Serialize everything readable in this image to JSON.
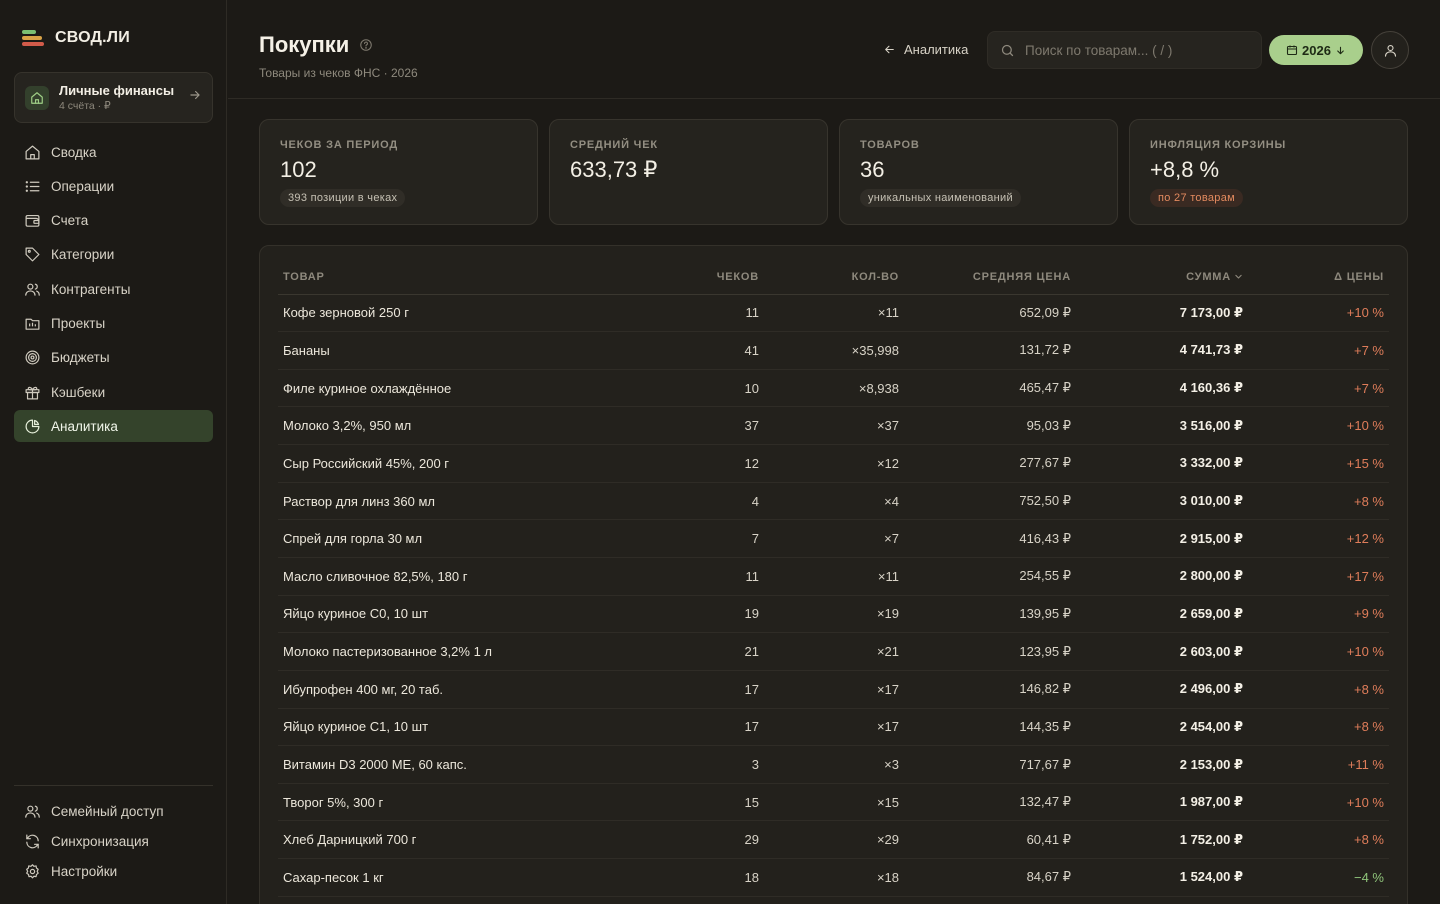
{
  "app": {
    "logo": "СВОД.ЛИ"
  },
  "account": {
    "name": "Личные финансы",
    "sub": "4 счёта · ₽"
  },
  "nav": [
    {
      "label": "Сводка",
      "icon": "home-icon"
    },
    {
      "label": "Операции",
      "icon": "list-icon"
    },
    {
      "label": "Счета",
      "icon": "wallet-icon"
    },
    {
      "label": "Категории",
      "icon": "tag-icon"
    },
    {
      "label": "Контрагенты",
      "icon": "users-icon"
    },
    {
      "label": "Проекты",
      "icon": "folder-icon"
    },
    {
      "label": "Бюджеты",
      "icon": "target-icon"
    },
    {
      "label": "Кэшбеки",
      "icon": "gift-icon"
    },
    {
      "label": "Аналитика",
      "icon": "pie-chart-icon",
      "active": true
    }
  ],
  "nav_bottom": [
    {
      "label": "Семейный доступ",
      "icon": "family-icon"
    },
    {
      "label": "Синхронизация",
      "icon": "sync-icon"
    },
    {
      "label": "Настройки",
      "icon": "gear-icon"
    }
  ],
  "header": {
    "title": "Покупки",
    "subtitle": "Товары из чеков ФНС · 2026",
    "back_label": "Аналитика",
    "search_placeholder": "Поиск по товарам... ( / )",
    "year": "2026"
  },
  "stats": [
    {
      "label": "ЧЕКОВ ЗА ПЕРИОД",
      "value": "102",
      "badge": "393 позиции в чеках",
      "badge_style": "neutral"
    },
    {
      "label": "СРЕДНИЙ ЧЕК",
      "value": "633,73 ₽",
      "badge": "",
      "badge_style": "none"
    },
    {
      "label": "ТОВАРОВ",
      "value": "36",
      "badge": "уникальных наименований",
      "badge_style": "neutral"
    },
    {
      "label": "ИНФЛЯЦИЯ КОРЗИНЫ",
      "value": "+8,8 %",
      "badge": "по 27 товарам",
      "badge_style": "warn"
    }
  ],
  "table": {
    "columns": [
      "ТОВАР",
      "ЧЕКОВ",
      "КОЛ-ВО",
      "СРЕДНЯЯ ЦЕНА",
      "СУММА",
      "Δ ЦЕНЫ"
    ],
    "rows": [
      {
        "name": "Кофе зерновой 250 г",
        "checks": "11",
        "qty": "×11",
        "avg": "652,09 ₽",
        "sum": "7 173,00 ₽",
        "delta": "+10 %",
        "trend": "up"
      },
      {
        "name": "Бананы",
        "checks": "41",
        "qty": "×35,998",
        "avg": "131,72 ₽",
        "sum": "4 741,73 ₽",
        "delta": "+7 %",
        "trend": "up"
      },
      {
        "name": "Филе куриное охлаждённое",
        "checks": "10",
        "qty": "×8,938",
        "avg": "465,47 ₽",
        "sum": "4 160,36 ₽",
        "delta": "+7 %",
        "trend": "up"
      },
      {
        "name": "Молоко 3,2%, 950 мл",
        "checks": "37",
        "qty": "×37",
        "avg": "95,03 ₽",
        "sum": "3 516,00 ₽",
        "delta": "+10 %",
        "trend": "up"
      },
      {
        "name": "Сыр Российский 45%, 200 г",
        "checks": "12",
        "qty": "×12",
        "avg": "277,67 ₽",
        "sum": "3 332,00 ₽",
        "delta": "+15 %",
        "trend": "up"
      },
      {
        "name": "Раствор для линз 360 мл",
        "checks": "4",
        "qty": "×4",
        "avg": "752,50 ₽",
        "sum": "3 010,00 ₽",
        "delta": "+8 %",
        "trend": "up"
      },
      {
        "name": "Спрей для горла 30 мл",
        "checks": "7",
        "qty": "×7",
        "avg": "416,43 ₽",
        "sum": "2 915,00 ₽",
        "delta": "+12 %",
        "trend": "up"
      },
      {
        "name": "Масло сливочное 82,5%, 180 г",
        "checks": "11",
        "qty": "×11",
        "avg": "254,55 ₽",
        "sum": "2 800,00 ₽",
        "delta": "+17 %",
        "trend": "up"
      },
      {
        "name": "Яйцо куриное С0, 10 шт",
        "checks": "19",
        "qty": "×19",
        "avg": "139,95 ₽",
        "sum": "2 659,00 ₽",
        "delta": "+9 %",
        "trend": "up"
      },
      {
        "name": "Молоко пастеризованное 3,2% 1 л",
        "checks": "21",
        "qty": "×21",
        "avg": "123,95 ₽",
        "sum": "2 603,00 ₽",
        "delta": "+10 %",
        "trend": "up"
      },
      {
        "name": "Ибупрофен 400 мг, 20 таб.",
        "checks": "17",
        "qty": "×17",
        "avg": "146,82 ₽",
        "sum": "2 496,00 ₽",
        "delta": "+8 %",
        "trend": "up"
      },
      {
        "name": "Яйцо куриное С1, 10 шт",
        "checks": "17",
        "qty": "×17",
        "avg": "144,35 ₽",
        "sum": "2 454,00 ₽",
        "delta": "+8 %",
        "trend": "up"
      },
      {
        "name": "Витамин D3 2000 МЕ, 60 капс.",
        "checks": "3",
        "qty": "×3",
        "avg": "717,67 ₽",
        "sum": "2 153,00 ₽",
        "delta": "+11 %",
        "trend": "up"
      },
      {
        "name": "Творог 5%, 300 г",
        "checks": "15",
        "qty": "×15",
        "avg": "132,47 ₽",
        "sum": "1 987,00 ₽",
        "delta": "+10 %",
        "trend": "up"
      },
      {
        "name": "Хлеб Дарницкий 700 г",
        "checks": "29",
        "qty": "×29",
        "avg": "60,41 ₽",
        "sum": "1 752,00 ₽",
        "delta": "+8 %",
        "trend": "up"
      },
      {
        "name": "Сахар-песок 1 кг",
        "checks": "18",
        "qty": "×18",
        "avg": "84,67 ₽",
        "sum": "1 524,00 ₽",
        "delta": "−4 %",
        "trend": "down"
      }
    ]
  }
}
